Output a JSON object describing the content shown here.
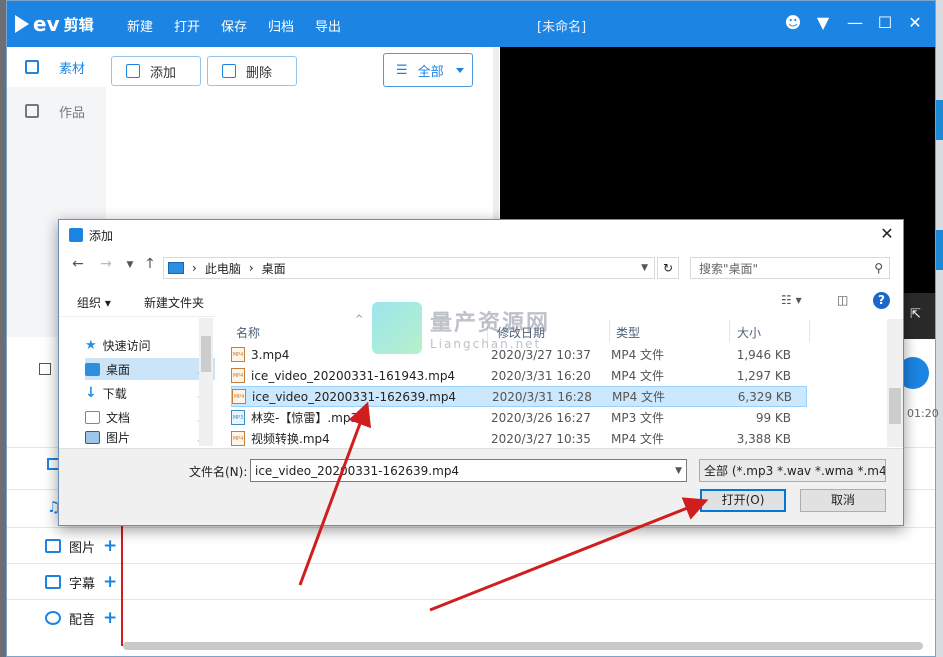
{
  "app": {
    "logo_text": "ev",
    "logo_cn": "剪辑",
    "menu": [
      "新建",
      "打开",
      "保存",
      "归档",
      "导出"
    ],
    "document_title": "[未命名]"
  },
  "left_nav": {
    "items": [
      {
        "label": "素材",
        "icon": "grid-icon",
        "active": true
      },
      {
        "label": "作品",
        "icon": "folder-icon",
        "active": false
      }
    ]
  },
  "toolbar": {
    "add_label": "添加",
    "delete_label": "删除",
    "filter_label": "全部"
  },
  "timeline": {
    "time_mark": "01:20",
    "tracks": [
      {
        "label": "图片",
        "icon": "image-icon"
      },
      {
        "label": "字幕",
        "icon": "text-icon"
      },
      {
        "label": "配音",
        "icon": "microphone-icon"
      }
    ]
  },
  "dialog": {
    "title": "添加",
    "address": {
      "root": "此电脑",
      "current": "桌面"
    },
    "search_placeholder": "搜索\"桌面\"",
    "commands": {
      "organize": "组织 ▾",
      "new_folder": "新建文件夹"
    },
    "tree": [
      {
        "label": "快速访问",
        "icon": "star-icon",
        "pinned": false
      },
      {
        "label": "桌面",
        "icon": "desktop-icon",
        "pinned": true,
        "selected": true
      },
      {
        "label": "下载",
        "icon": "download-icon",
        "pinned": true
      },
      {
        "label": "文档",
        "icon": "document-icon",
        "pinned": true
      },
      {
        "label": "图片",
        "icon": "picture-icon",
        "pinned": true
      }
    ],
    "columns": {
      "name": "名称",
      "date": "修改日期",
      "type": "类型",
      "size": "大小"
    },
    "files": [
      {
        "name": "3.mp4",
        "date": "2020/3/27 10:37",
        "type": "MP4 文件",
        "size": "1,946 KB",
        "kind": "mp4"
      },
      {
        "name": "ice_video_20200331-161943.mp4",
        "date": "2020/3/31 16:20",
        "type": "MP4 文件",
        "size": "1,297 KB",
        "kind": "mp4"
      },
      {
        "name": "ice_video_20200331-162639.mp4",
        "date": "2020/3/31 16:28",
        "type": "MP4 文件",
        "size": "6,329 KB",
        "kind": "mp4",
        "selected": true
      },
      {
        "name": "林奕-【惊雷】.mp3",
        "date": "2020/3/26 16:27",
        "type": "MP3 文件",
        "size": "99 KB",
        "kind": "mp3"
      },
      {
        "name": "视频转换.mp4",
        "date": "2020/3/27 10:35",
        "type": "MP4 文件",
        "size": "3,388 KB",
        "kind": "mp4"
      }
    ],
    "filename_label": "文件名(N):",
    "filename_value": "ice_video_20200331-162639.mp4",
    "filetype_value": "全部 (*.mp3 *.wav *.wma *.m4",
    "open_label": "打开(O)",
    "cancel_label": "取消"
  },
  "watermark": {
    "cn": "量产资源网",
    "en": "Liangchan.net"
  },
  "colors": {
    "accent": "#1c84e3",
    "arrow": "#d01e1e",
    "selection": "#cce8ff"
  }
}
